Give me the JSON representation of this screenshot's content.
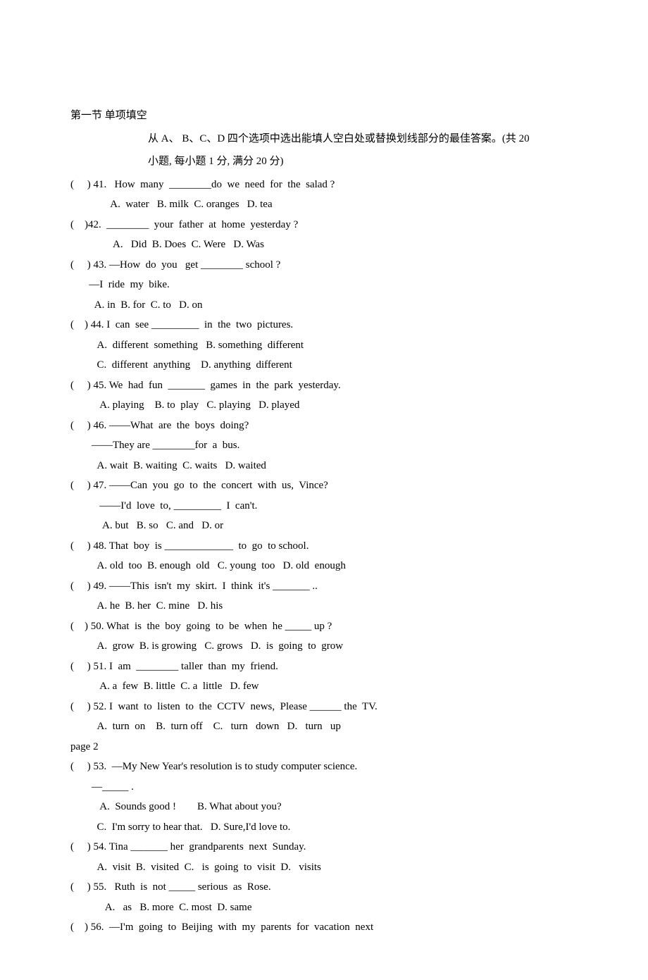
{
  "section": {
    "title": "第一节   单项填空",
    "instructions_line1": "从 A、 B、C、D 四个选项中选出能填人空白处或替换划线部分的最佳答案。(共 20",
    "instructions_line2": "小题, 每小题 1 分, 满分 20 分)"
  },
  "page_marker": "page 2",
  "questions": [
    {
      "num": "41",
      "prompt": "(     ) 41.   How  many  ________do  we  need  for  the  salad ?",
      "opts": "               A.  water   B. milk  C. oranges   D. tea"
    },
    {
      "num": "42",
      "prompt": "(    )42.  ________  your  father  at  home  yesterday ?",
      "opts": "                A.   Did  B. Does  C. Were   D. Was"
    },
    {
      "num": "43",
      "prompt": "(     ) 43. —How  do  you   get ________ school ?",
      "mid": "       —I  ride  my  bike.",
      "opts": "         A. in  B. for  C. to   D. on"
    },
    {
      "num": "44",
      "prompt": "(    ) 44. I  can  see _________  in  the  two  pictures.",
      "opts": "          A.  different  something   B. something  different",
      "opts2": "          C.  different  anything    D. anything  different"
    },
    {
      "num": "45",
      "prompt": "(     ) 45. We  had  fun  _______  games  in  the  park  yesterday.",
      "opts": "           A. playing    B. to  play   C. playing   D. played"
    },
    {
      "num": "46",
      "prompt": "(     ) 46. ——What  are  the  boys  doing?",
      "mid": "        ——They are ________for  a  bus.",
      "opts": "          A. wait  B. waiting  C. waits   D. waited"
    },
    {
      "num": "47",
      "prompt": "(     ) 47. ——Can  you  go  to  the  concert  with  us,  Vince?",
      "mid": "           ——I'd  love  to, _________  I  can't.",
      "opts": "            A. but   B. so   C. and   D. or"
    },
    {
      "num": "48",
      "prompt": "(     ) 48. That  boy  is _____________  to  go  to school.",
      "opts": "          A. old  too  B. enough  old   C. young  too   D. old  enough"
    },
    {
      "num": "49",
      "prompt": "(     ) 49. ——This  isn't  my  skirt.  I  think  it's _______ ..",
      "opts": "          A. he  B. her  C. mine   D. his"
    },
    {
      "num": "50",
      "prompt": "(    ) 50. What  is  the  boy  going  to  be  when  he _____ up ?",
      "opts": "          A.  grow  B. is growing   C. grows   D.  is  going  to  grow"
    },
    {
      "num": "51",
      "prompt": "(     ) 51. I  am  ________ taller  than  my  friend.",
      "opts": "           A. a  few  B. little  C. a  little   D. few"
    },
    {
      "num": "52",
      "prompt": "(     ) 52. I  want  to  listen  to  the  CCTV  news,  Please ______ the  TV.",
      "opts": "          A.  turn  on    B.  turn off    C.   turn   down   D.   turn   up"
    },
    {
      "num": "53",
      "prompt": "(     ) 53.  —My New Year's resolution is to study computer science.",
      "mid": "        —_____ .",
      "opts": "           A.  Sounds good !        B. What about you?",
      "opts2": "          C.  I'm sorry to hear that.   D. Sure,I'd love to."
    },
    {
      "num": "54",
      "prompt": "(     ) 54. Tina _______ her  grandparents  next  Sunday.",
      "opts": "          A.  visit  B.  visited  C.   is  going  to  visit  D.   visits"
    },
    {
      "num": "55",
      "prompt": "(     ) 55.   Ruth  is  not _____ serious  as  Rose.",
      "opts": "             A.   as   B. more  C. most  D. same"
    },
    {
      "num": "56",
      "prompt": "(    ) 56.  —I'm  going  to  Beijing  with  my  parents  for  vacation  next"
    }
  ]
}
